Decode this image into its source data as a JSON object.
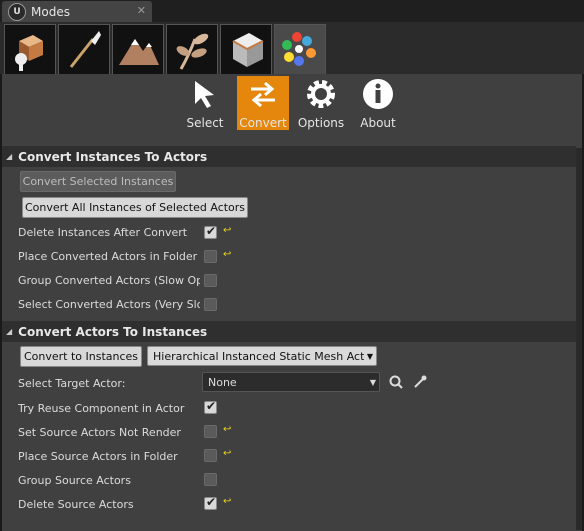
{
  "window": {
    "tab_title": "Modes",
    "close_glyph": "✕",
    "logo_glyph": "U"
  },
  "mode_icons": [
    "place-icon",
    "paint-icon",
    "landscape-icon",
    "foliage-icon",
    "geometry-icon",
    "extension-icon"
  ],
  "tools": [
    {
      "label": "Select"
    },
    {
      "label": "Convert"
    },
    {
      "label": "Options"
    },
    {
      "label": "About"
    }
  ],
  "sections": {
    "to_actors": {
      "title": "Convert Instances To Actors",
      "btn_selected": "Convert Selected Instances",
      "btn_all": "Convert All Instances of Selected Actors",
      "props": [
        {
          "label": "Delete Instances After Convert",
          "checked": true,
          "reset": true
        },
        {
          "label": "Place Converted Actors in Folder",
          "checked": false,
          "reset": true
        },
        {
          "label": "Group Converted Actors (Slow Operation)",
          "checked": false,
          "reset": false
        },
        {
          "label": "Select Converted Actors (Very Slow)",
          "checked": false,
          "reset": false
        }
      ]
    },
    "to_instances": {
      "title": "Convert Actors To Instances",
      "btn_convert": "Convert to Instances",
      "component_type": "Hierarchical Instanced Static Mesh Actor",
      "target_label": "Select Target Actor:",
      "target_value": "None",
      "props": [
        {
          "label": "Try Reuse Component in Actor",
          "checked": true,
          "reset": false
        },
        {
          "label": "Set Source Actors Not Render",
          "checked": false,
          "reset": true
        },
        {
          "label": "Place Source Actors in Folder",
          "checked": false,
          "reset": true
        },
        {
          "label": "Group Source Actors",
          "checked": false,
          "reset": false
        },
        {
          "label": "Delete Source Actors",
          "checked": true,
          "reset": true
        }
      ]
    }
  },
  "glyphs": {
    "collapse": "◢",
    "dropdown": "▼",
    "check": "✔",
    "reset": "↩"
  },
  "colors": {
    "accent": "#e5860d",
    "panel": "#404040",
    "header": "#2f2f2f",
    "reset_arrow": "#e6d21a"
  }
}
